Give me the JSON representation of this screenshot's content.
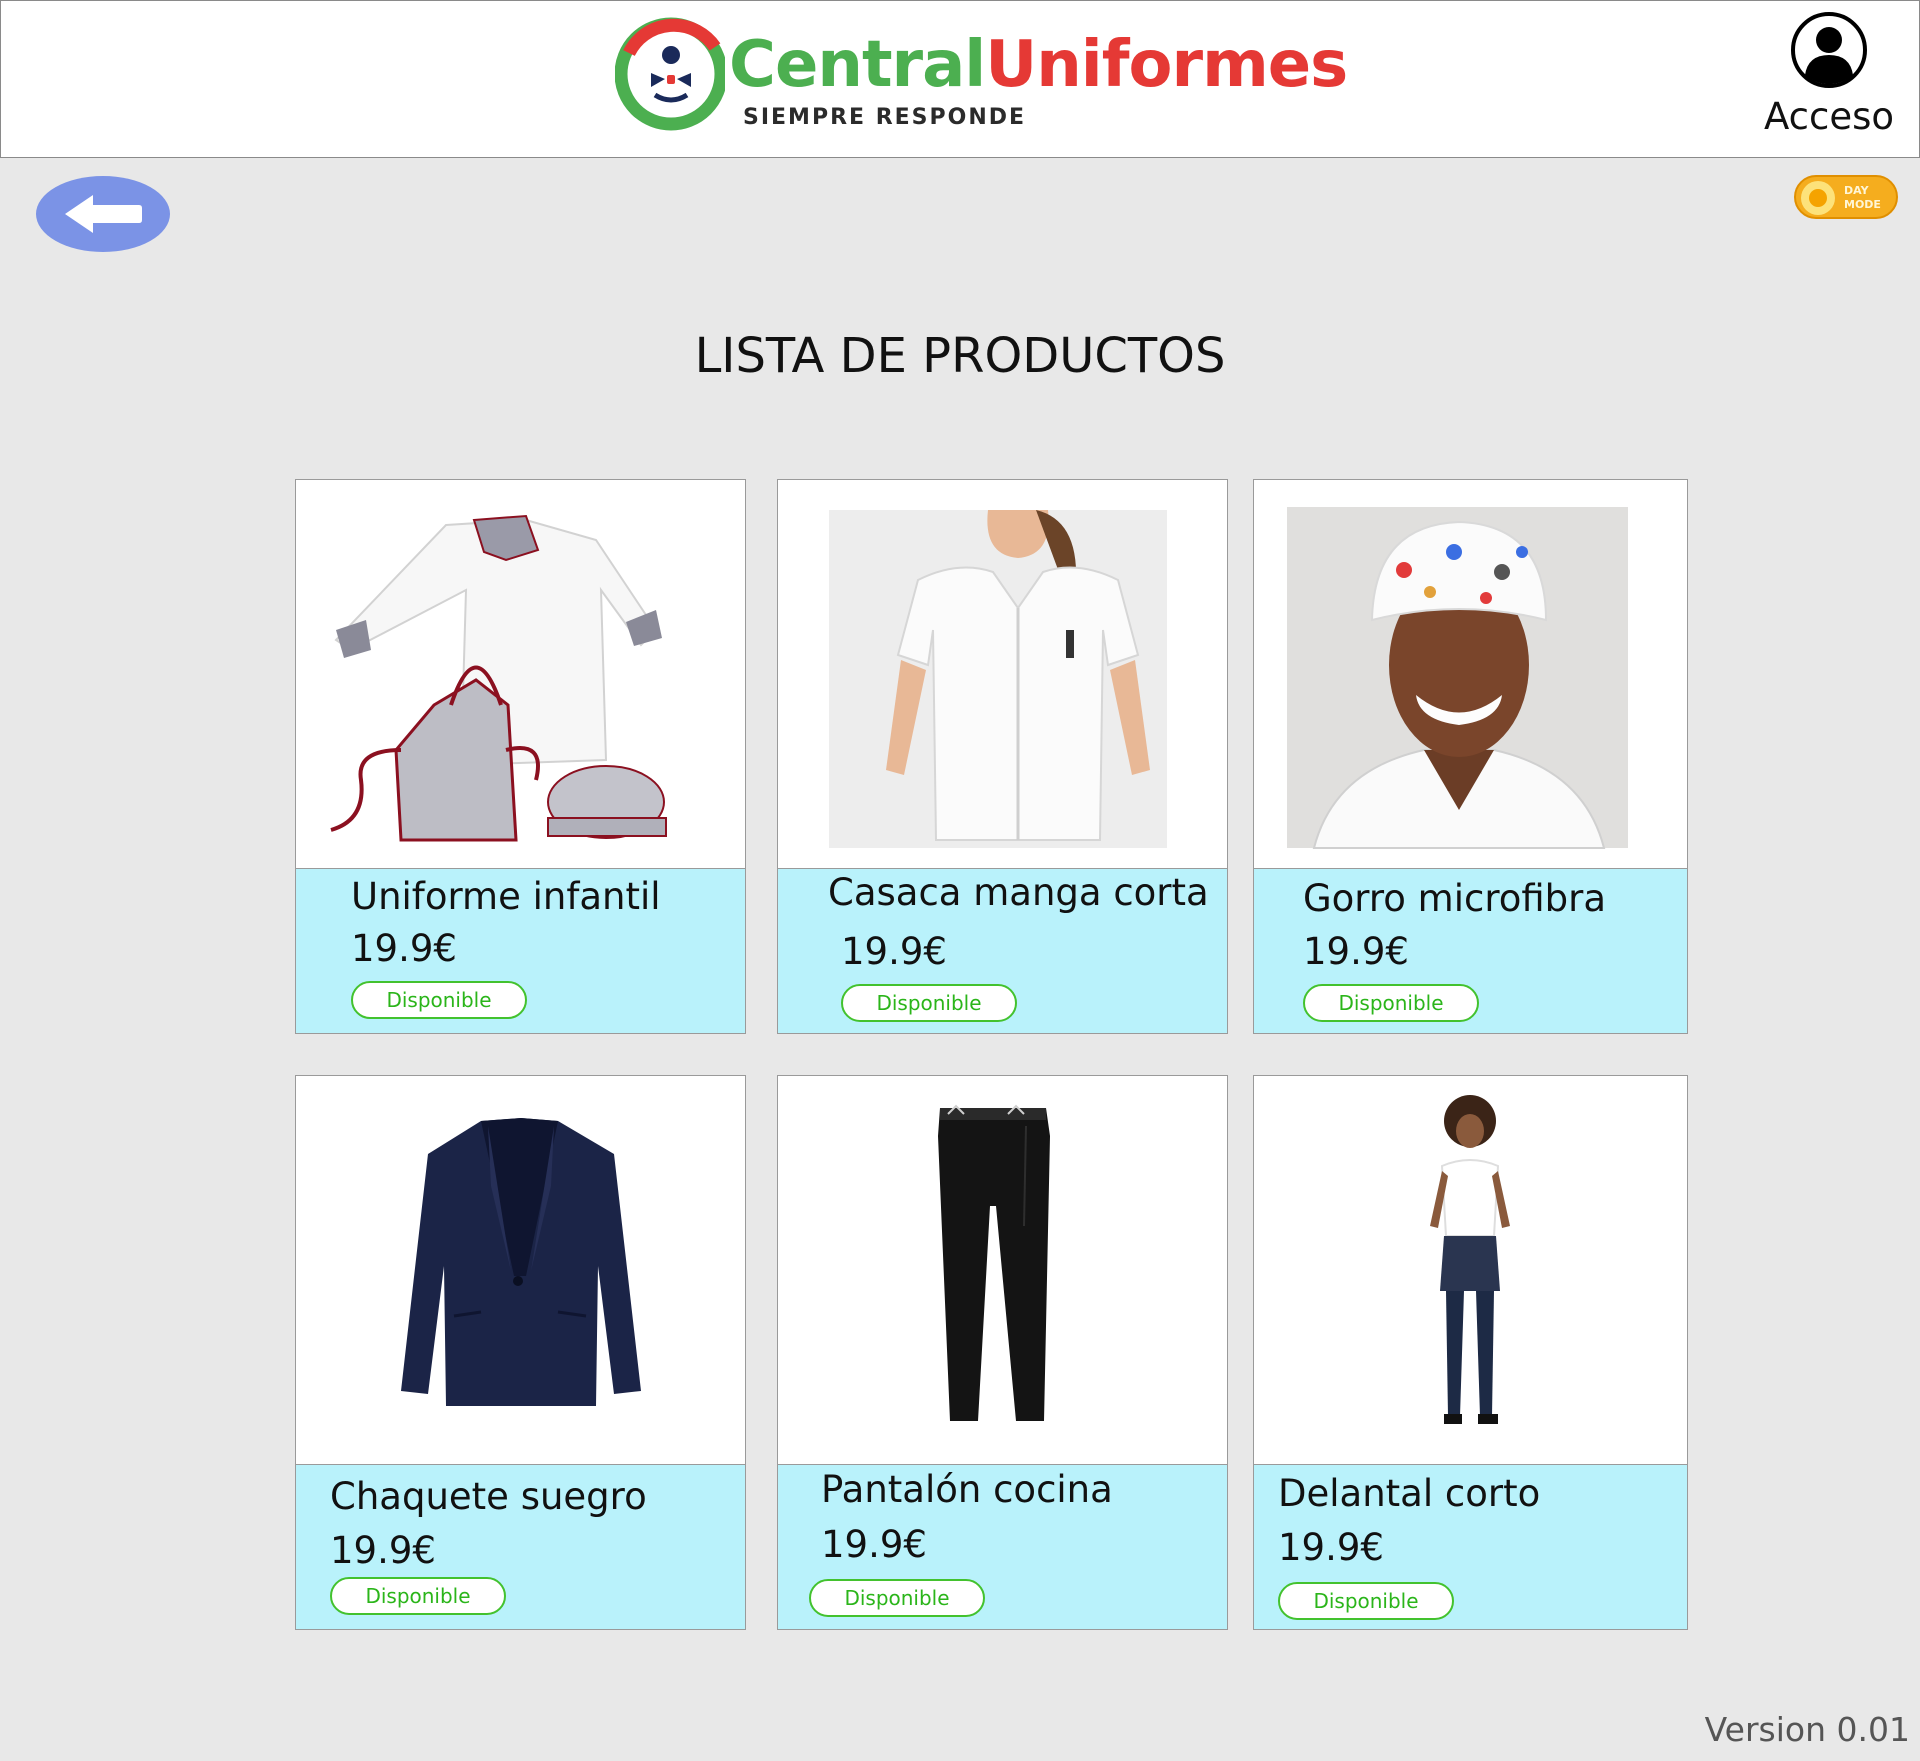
{
  "header": {
    "brand": {
      "part1": "Central",
      "part2": "Uniformes",
      "tagline": "SIEMPRE RESPONDE"
    },
    "account_label": "Acceso"
  },
  "toolbar": {
    "back_icon": "arrow-left-icon",
    "day_mode": {
      "line1": "DAY",
      "line2": "MODE"
    }
  },
  "page": {
    "title": "LISTA DE PRODUCTOS"
  },
  "products": [
    {
      "name": "Uniforme infantil",
      "price": "19.9€",
      "status": "Disponible",
      "image": "kids-chef-uniform"
    },
    {
      "name": "Casaca manga corta",
      "price": "19.9€",
      "status": "Disponible",
      "image": "white-short-sleeve-tunic"
    },
    {
      "name": "Gorro microfibra",
      "price": "19.9€",
      "status": "Disponible",
      "image": "printed-microfiber-cap"
    },
    {
      "name": "Chaquete suegro",
      "price": "19.9€",
      "status": "Disponible",
      "image": "navy-blazer"
    },
    {
      "name": "Pantalón cocina",
      "price": "19.9€",
      "status": "Disponible",
      "image": "black-kitchen-trousers"
    },
    {
      "name": "Delantal corto",
      "price": "19.9€",
      "status": "Disponible",
      "image": "short-denim-apron"
    }
  ],
  "footer": {
    "version": "Version 0.01"
  },
  "colors": {
    "accent_blue": "#7b93e6",
    "card_info_bg": "#b9f2fb",
    "badge_green": "#43c22e",
    "brand_green": "#4caf50",
    "brand_red": "#e53935"
  }
}
